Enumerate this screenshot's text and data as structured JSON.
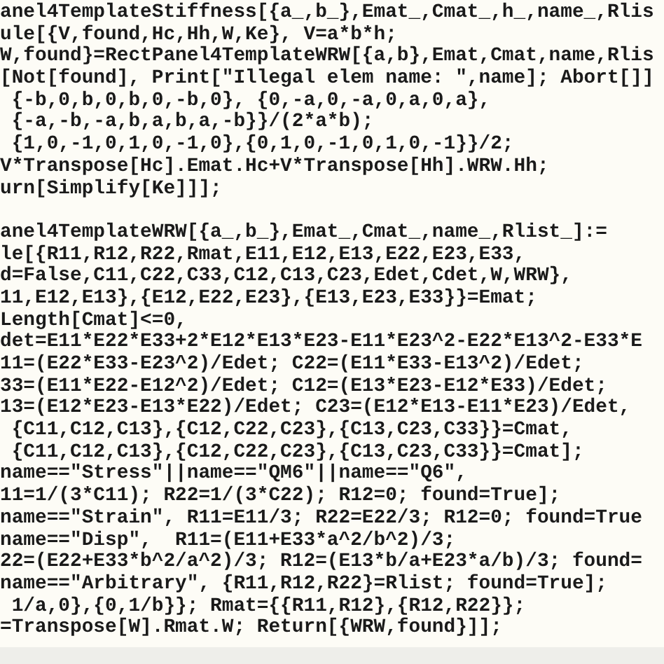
{
  "code_lines": [
    {
      "kind": "text",
      "text": "anel4TemplateStiffness[{a_,b_},Emat_,Cmat_,h_,name_,Rlis"
    },
    {
      "kind": "text",
      "text": "ule[{V,found,Hc,Hh,W,Ke}, V=a*b*h;"
    },
    {
      "kind": "text",
      "text": "W,found}=RectPanel4TemplateWRW[{a,b},Emat,Cmat,name,Rlis"
    },
    {
      "kind": "text",
      "text": "[Not[found], Print[\"Illegal elem name: \",name]; Abort[]]"
    },
    {
      "kind": "text",
      "text": " {-b,0,b,0,b,0,-b,0}, {0,-a,0,-a,0,a,0,a},"
    },
    {
      "kind": "text",
      "text": " {-a,-b,-a,b,a,b,a,-b}}/(2*a*b);"
    },
    {
      "kind": "text",
      "text": " {1,0,-1,0,1,0,-1,0},{0,1,0,-1,0,1,0,-1}}/2;"
    },
    {
      "kind": "text",
      "text": "V*Transpose[Hc].Emat.Hc+V*Transpose[Hh].WRW.Hh;"
    },
    {
      "kind": "text",
      "text": "urn[Simplify[Ke]]];"
    },
    {
      "kind": "blank"
    },
    {
      "kind": "text",
      "text": "anel4TemplateWRW[{a_,b_},Emat_,Cmat_,name_,Rlist_]:="
    },
    {
      "kind": "text",
      "text": "le[{R11,R12,R22,Rmat,E11,E12,E13,E22,E23,E33,"
    },
    {
      "kind": "text",
      "text": "d=False,C11,C22,C33,C12,C13,C23,Edet,Cdet,W,WRW},"
    },
    {
      "kind": "text",
      "text": "11,E12,E13},{E12,E22,E23},{E13,E23,E33}}=Emat;"
    },
    {
      "kind": "text",
      "text": "Length[Cmat]<=0,"
    },
    {
      "kind": "text",
      "text": "det=E11*E22*E33+2*E12*E13*E23-E11*E23^2-E22*E13^2-E33*E"
    },
    {
      "kind": "text",
      "text": "11=(E22*E33-E23^2)/Edet; C22=(E11*E33-E13^2)/Edet;"
    },
    {
      "kind": "text",
      "text": "33=(E11*E22-E12^2)/Edet; C12=(E13*E23-E12*E33)/Edet;"
    },
    {
      "kind": "text",
      "text": "13=(E12*E23-E13*E22)/Edet; C23=(E12*E13-E11*E23)/Edet,"
    },
    {
      "kind": "text",
      "text": " {C11,C12,C13},{C12,C22,C23},{C13,C23,C33}}=Cmat,"
    },
    {
      "kind": "text",
      "text": " {C11,C12,C13},{C12,C22,C23},{C13,C23,C33}}=Cmat];"
    },
    {
      "kind": "text",
      "text": "name==\"Stress\"||name==\"QM6\"||name==\"Q6\","
    },
    {
      "kind": "text",
      "text": "11=1/(3*C11); R22=1/(3*C22); R12=0; found=True];"
    },
    {
      "kind": "text",
      "text": "name==\"Strain\", R11=E11/3; R22=E22/3; R12=0; found=True"
    },
    {
      "kind": "text",
      "text": "name==\"Disp\",  R11=(E11+E33*a^2/b^2)/3;"
    },
    {
      "kind": "text",
      "text": "22=(E22+E33*b^2/a^2)/3; R12=(E13*b/a+E23*a/b)/3; found="
    },
    {
      "kind": "text",
      "text": "name==\"Arbitrary\", {R11,R12,R22}=Rlist; found=True];"
    },
    {
      "kind": "text",
      "text": " 1/a,0},{0,1/b}}; Rmat={{R11,R12},{R12,R22}};"
    },
    {
      "kind": "text",
      "text": "=Transpose[W].Rmat.W; Return[{WRW,found}]];"
    }
  ]
}
